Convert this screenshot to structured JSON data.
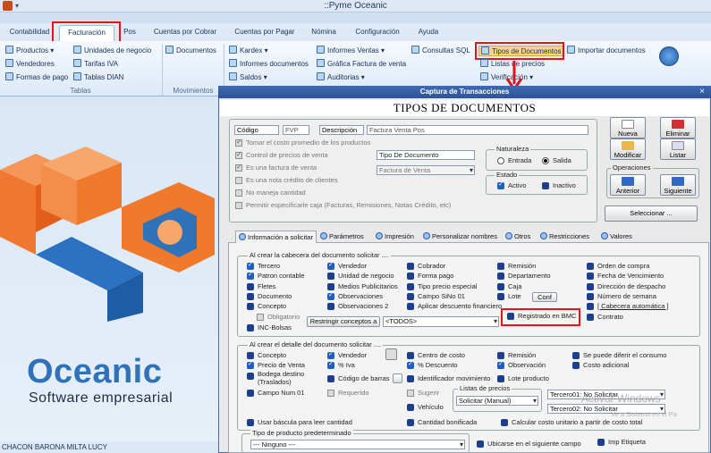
{
  "app": {
    "title": "::Pyme Oceanic",
    "qa_arrow": "▾"
  },
  "tabs": [
    "Contabilidad",
    "Facturación",
    "Pos",
    "Cuentas por Cobrar",
    "Cuentas por Pagar",
    "Nómina",
    "Configuración",
    "Ayuda"
  ],
  "ribbon": {
    "tablas": {
      "group": "Tablas",
      "items": [
        "Productos",
        "Unidades de negocio",
        "Vendedores",
        "Tarifas IVA",
        "Formas de pago",
        "Tablas DIAN"
      ]
    },
    "movimientos": {
      "group": "Movimientos",
      "items": [
        "Documentos"
      ]
    },
    "other": {
      "kardex": "Kardex",
      "informes_ventas": "Informes Ventas",
      "consultas_sql": "Consultas SQL",
      "tipos_documentos": "Tipos de Documentos",
      "importar_documentos": "Importar documentos",
      "informes_documentos": "Informes documentos",
      "grafica_factura": "Gráfica Factura de venta",
      "listas_precios": "Listas de precios",
      "saldos": "Saldos",
      "auditorias": "Auditorias",
      "verificacion": "Verificación"
    }
  },
  "logo": {
    "name": "Oceanic",
    "tagline": "Software empresarial"
  },
  "footer": {
    "user": "CHACON BARONA MILTA LUCY"
  },
  "dialog": {
    "window_title": "Captura de Transacciones",
    "close": "×",
    "heading": "TIPOS DE DOCUMENTOS",
    "codigo_label": "Código",
    "codigo_value": "FVP",
    "descripcion_label": "Descripción",
    "descripcion_value": "Factura Venta Pos",
    "options": [
      "Tomar el costo promedio de los productos",
      "Control de precios de venta",
      "Es una factura de venta",
      "Es una nota crédito de clientes",
      "No maneja cantidad",
      "Permitir especificarle caja  (Facturas, Remisiones, Notas Crédito, etc)"
    ],
    "tipo_documento_value": "Tipo De Documento",
    "tipo_select_value": "Factura de Venta",
    "naturaleza": {
      "title": "Naturaleza",
      "entrada": "Entrada",
      "salida": "Salida"
    },
    "estado": {
      "title": "Estado",
      "activo": "Activo",
      "inactivo": "Inactivo"
    },
    "buttons": {
      "nueva": "Nueva",
      "eliminar": "Eliminar",
      "modificar": "Modificar",
      "listar": "Listar",
      "operaciones": "Operaciones",
      "anterior": "Anterior",
      "siguiente": "Siguiente",
      "seleccionar": "Seleccionar ..."
    },
    "subtabs": [
      "Información a solicitar",
      "Parámetros",
      "Impresión",
      "Personalizar nombres",
      "Otros",
      "Restricciones",
      "Valores"
    ],
    "cabecera": {
      "title": "Al crear la cabecera del documento solicitar ....",
      "col1": [
        "Tercero",
        "Patron contable",
        "Fletes",
        "Documento",
        "Concepto"
      ],
      "col2": [
        "Vendedor",
        "Unidad de negocio",
        "Medios Publicitarios",
        "Observaciones",
        "Observaciones 2"
      ],
      "col3": [
        "Cobrador",
        "Forma pago",
        "Tipo precio especial",
        "Campo SiNo 01",
        "Aplicar descuento financiero"
      ],
      "col4": [
        "Remisión",
        "Departamento",
        "Caja",
        "Lote"
      ],
      "col5": [
        "Orden de compra",
        "Fecha de Vencimiento",
        "Dirección de despacho",
        "Número de semana",
        "[ Cabecera automática ]",
        "Contrato"
      ],
      "conf": "Conf",
      "registrado_bmc": "Registrado en BMC",
      "obligatorio": "Obligatorio",
      "inc_bolsas": "INC-Bolsas",
      "restringir": "Restringir conceptos a",
      "todos": "<TODOS>"
    },
    "detalle": {
      "title": "Al crear  el detalle del documento solicitar ....",
      "col1": [
        "Concepto",
        "Precio de Venta",
        "Bodega destino (Traslados)",
        "Campo Num 01"
      ],
      "col2": [
        "Vendedor",
        "% Iva",
        "Código de barras",
        "Requerido"
      ],
      "col3": [
        "Centro de costo",
        "% Descuento",
        "Identificador movimiento",
        "Sugerir",
        "Vehículo"
      ],
      "col4": [
        "Remisión",
        "Observación",
        "Lote producto"
      ],
      "col5": [
        "Se puede diferir el consumo",
        "Costo adicional"
      ],
      "listas_precios": "Listas de precios",
      "listas_value": "Solicitar (Manual)",
      "tercero01": "Tercero01: No Solicitar",
      "tercero02": "Tercero02: No Solicitar",
      "bascula": "Usar báscula para leer cantidad",
      "bonificada": "Cantidad bonificada",
      "calcular": "Calcular costo unitario a partir de costo total",
      "tipo_producto": "Tipo de producto predeterminado",
      "ninguno": "--- Ninguno ---",
      "ubicarse": "Ubicarse en el siguiente campo",
      "imp_etiqueta": "Imp Etiqueta"
    },
    "watermark": {
      "line1": "Activar Windows",
      "line2": "Ve a Sistema en el Pa"
    }
  },
  "colors": {
    "highlight": "#e0141a",
    "logo_orange": "#f07a2c",
    "logo_blue": "#2f72b8"
  }
}
